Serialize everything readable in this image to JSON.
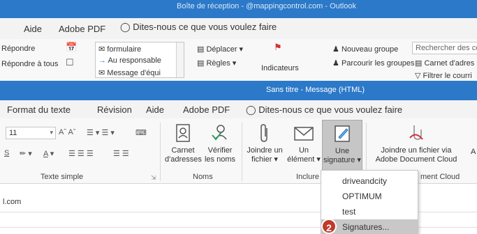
{
  "back_window": {
    "title": "Boîte de réception - @mappingcontrol.com - Outlook",
    "menu": {
      "aide": "Aide",
      "adobe_pdf": "Adobe PDF",
      "tell_me": "Dites-nous ce que vous voulez faire"
    },
    "ribbon": {
      "repondre": "Répondre",
      "repondre_a_tous": "Répondre à tous",
      "quick_steps": [
        "formulaire",
        "Au responsable",
        "Message d'équi"
      ],
      "deplacer": "Déplacer",
      "regles": "Règles",
      "indicateurs": "Indicateurs",
      "nouveau_groupe": "Nouveau groupe",
      "parcourir_groupes": "Parcourir les groupes",
      "search_placeholder": "Rechercher des co",
      "carnet": "Carnet d'adres",
      "filtrer": "Filtrer le courri"
    }
  },
  "front_window": {
    "title": "Sans titre - Message (HTML)",
    "menu": {
      "format": "Format du texte",
      "revision": "Révision",
      "aide": "Aide",
      "adobe_pdf": "Adobe PDF",
      "tell_me": "Dites-nous ce que vous voulez faire"
    },
    "ribbon": {
      "font_size": "11",
      "groups": {
        "texte_simple": "Texte simple",
        "noms": "Noms",
        "inclure": "Inclure",
        "adobe_cloud": "ment Cloud"
      },
      "carnet_line1": "Carnet",
      "carnet_line2": "d'adresses",
      "verifier_line1": "Vérifier",
      "verifier_line2": "les noms",
      "joindre_line1": "Joindre un",
      "joindre_line2": "fichier",
      "element_line1": "Un",
      "element_line2": "élément",
      "signature_line1": "Une",
      "signature_line2": "signature",
      "adobe_line1": "Joindre un fichier via",
      "adobe_line2": "Adobe Document Cloud",
      "trailing": "A"
    },
    "body": {
      "from_text": "l.com"
    }
  },
  "dropdown": {
    "items": [
      "driveandcity",
      "OPTIMUM",
      "test",
      "Signatures..."
    ],
    "highlighted_index": 3
  },
  "badge": "2",
  "colors": {
    "title_bar": "#2b79c8",
    "highlight": "#c8c8c8",
    "badge": "#c0392b"
  }
}
